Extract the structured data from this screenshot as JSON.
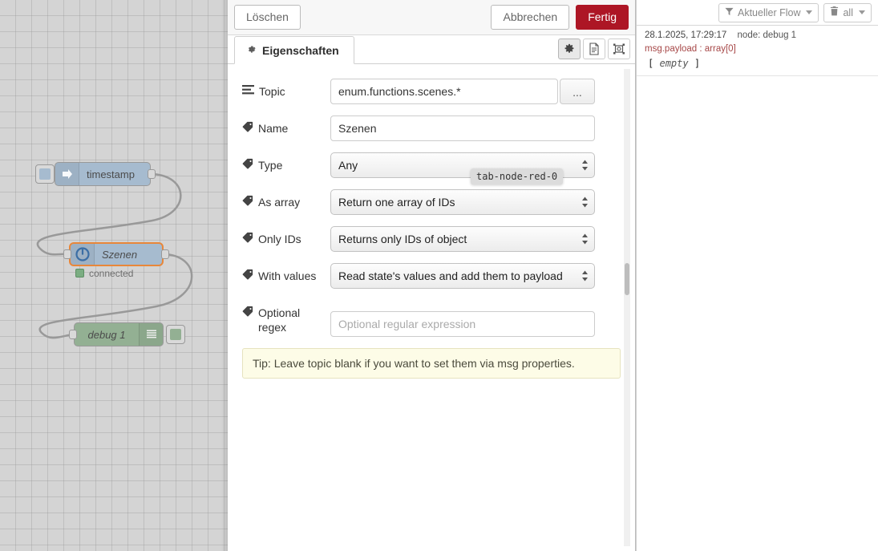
{
  "canvas": {
    "nodes": [
      {
        "id": "inject",
        "label": "timestamp",
        "status": "",
        "icon": "arrow-right-icon"
      },
      {
        "id": "szenen",
        "label": "Szenen",
        "status": "connected",
        "icon": "info-circle-icon"
      },
      {
        "id": "debug",
        "label": "debug 1",
        "status": "",
        "icon": "debug-lines-icon"
      }
    ]
  },
  "dialog": {
    "header": {
      "delete_label": "Löschen",
      "cancel_label": "Abbrechen",
      "done_label": "Fertig",
      "done_color": "#ad1625"
    },
    "tabs": [
      {
        "label": "Eigenschaften",
        "icon": "gear-icon",
        "active": true
      }
    ],
    "tab_icons": [
      {
        "name": "gear-icon",
        "active": true
      },
      {
        "name": "description-document-icon",
        "active": false
      },
      {
        "name": "appearance-layout-icon",
        "active": false
      }
    ],
    "tooltip": "tab-node-red-0",
    "fields": {
      "topic": {
        "label": "Topic",
        "icon": "list-bars-icon",
        "value": "enum.functions.scenes.*",
        "browse_label": "..."
      },
      "name": {
        "label": "Name",
        "icon": "tag-icon",
        "value": "Szenen"
      },
      "type": {
        "label": "Type",
        "icon": "tag-icon",
        "value": "Any"
      },
      "as_array": {
        "label": "As array",
        "icon": "tag-icon",
        "value": "Return one array of IDs"
      },
      "only_ids": {
        "label": "Only IDs",
        "icon": "tag-icon",
        "value": "Returns only IDs of object"
      },
      "with_values": {
        "label": "With values",
        "icon": "tag-icon",
        "value": "Read state's values and add them to payload"
      },
      "optional_regex": {
        "label": "Optional regex",
        "icon": "tag-icon",
        "value": "",
        "placeholder": "Optional regular expression"
      }
    },
    "tip": "Tip: Leave topic blank if you want to set them via msg properties."
  },
  "sidebar": {
    "filter_button": {
      "label": "Aktueller Flow",
      "icon": "filter-icon"
    },
    "clear_button": {
      "label": "all",
      "icon": "trash-icon"
    },
    "messages": [
      {
        "timestamp": "28.1.2025, 17:29:17",
        "node": "node: debug 1",
        "property": "msg.payload : array[0]",
        "value_prefix": "[",
        "value_body": "empty",
        "value_suffix": "]",
        "property_color": "#a64747"
      }
    ]
  }
}
